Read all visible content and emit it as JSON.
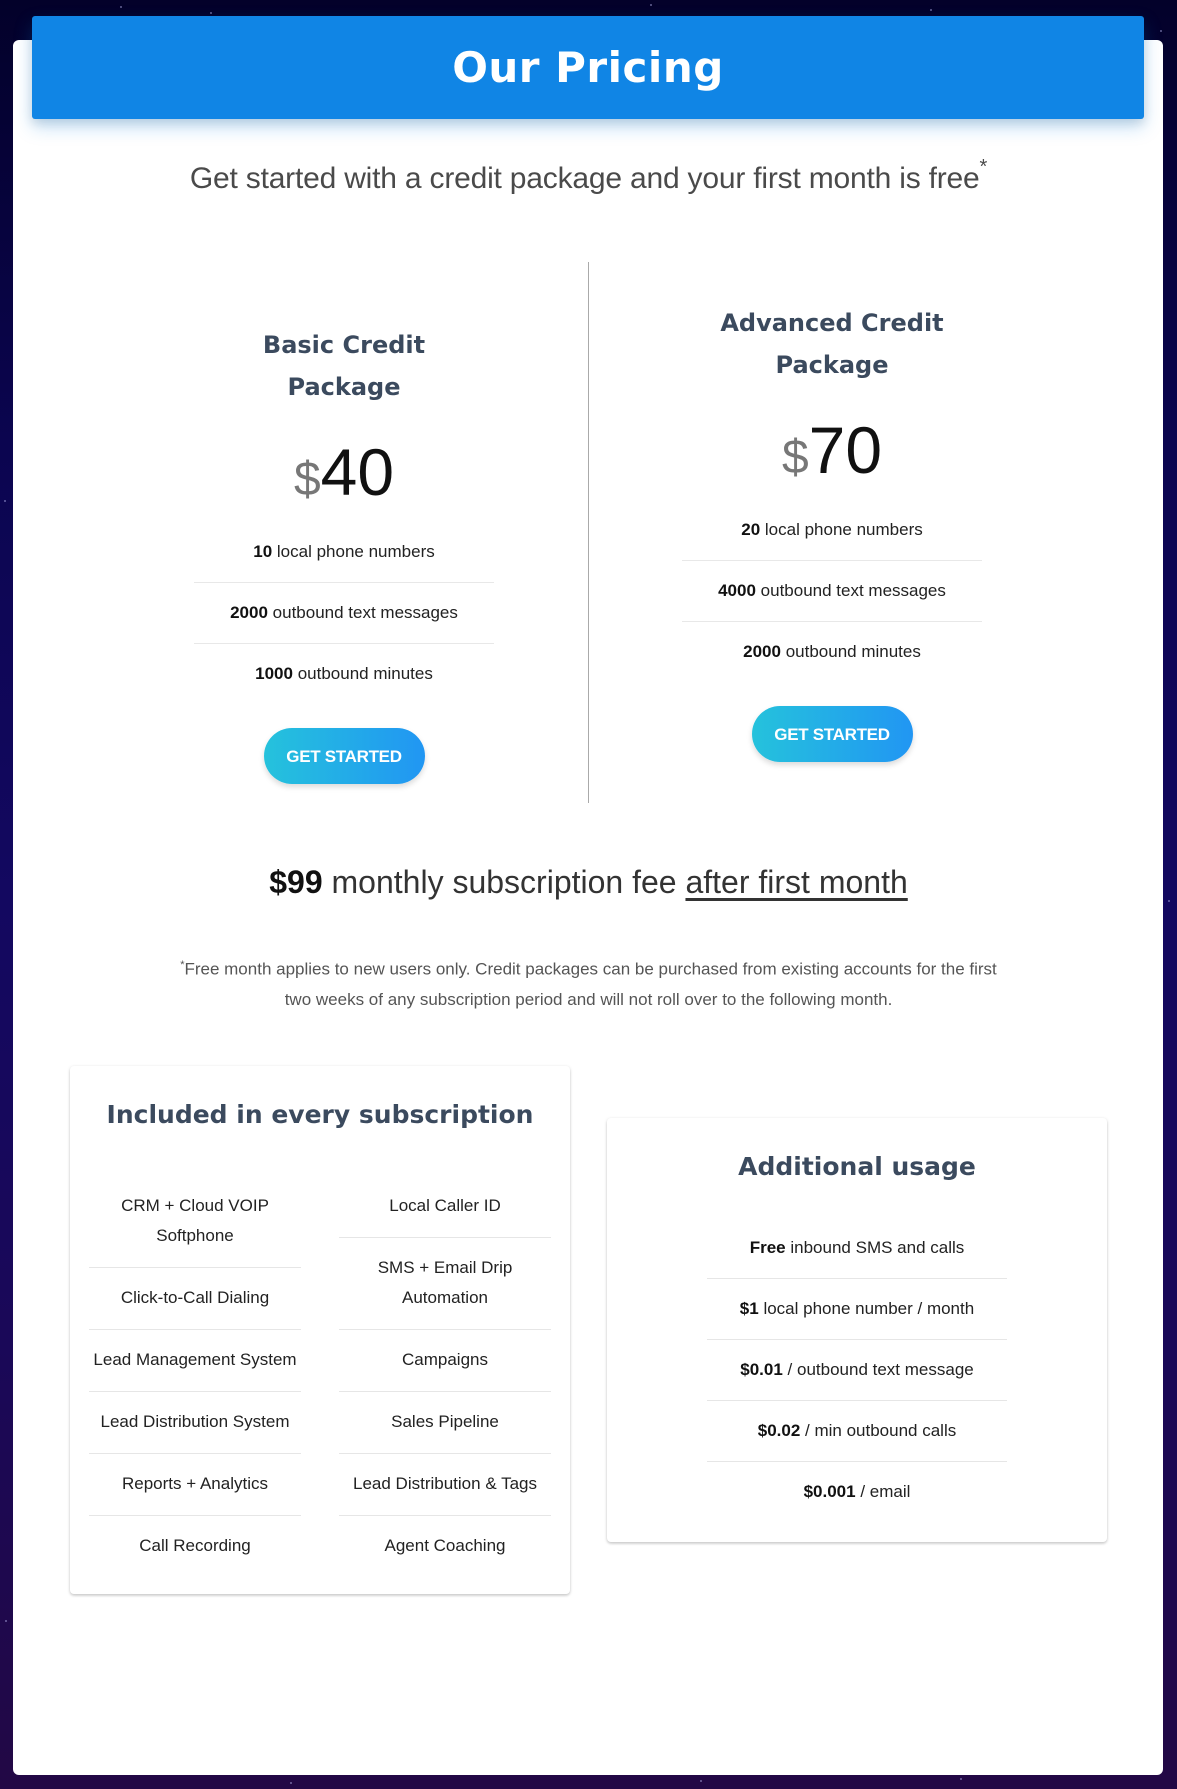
{
  "header": {
    "title": "Our Pricing",
    "color": "#1085e5"
  },
  "subtitle": {
    "text": "Get started with a credit package and your first month is free",
    "marker": "*"
  },
  "packages": [
    {
      "title": "Basic Credit Package",
      "currency": "$",
      "price": "40",
      "features": [
        {
          "value": "10",
          "label": "local phone numbers"
        },
        {
          "value": "2000",
          "label": "outbound text messages"
        },
        {
          "value": "1000",
          "label": "outbound minutes"
        }
      ],
      "button_label": "GET STARTED"
    },
    {
      "title": "Advanced Credit Package",
      "currency": "$",
      "price": "70",
      "features": [
        {
          "value": "20",
          "label": "local phone numbers"
        },
        {
          "value": "4000",
          "label": "outbound text messages"
        },
        {
          "value": "2000",
          "label": "outbound minutes"
        }
      ],
      "button_label": "GET STARTED"
    }
  ],
  "subscription": {
    "price": "$99",
    "text": "monthly subscription fee",
    "emphasis": "after first month"
  },
  "footnote": {
    "marker": "*",
    "text": "Free month applies to new users only. Credit packages can be purchased from existing accounts for the first two weeks of any subscription period and will not roll over to the following month."
  },
  "included": {
    "title": "Included in every subscription",
    "left": [
      "CRM + Cloud VOIP Softphone",
      "Click-to-Call Dialing",
      "Lead Management System",
      "Lead Distribution System",
      "Reports + Analytics",
      "Call Recording"
    ],
    "right": [
      "Local Caller ID",
      "SMS + Email Drip Automation",
      "Campaigns",
      "Sales Pipeline",
      "Lead Distribution & Tags",
      "Agent Coaching"
    ]
  },
  "additional": {
    "title": "Additional usage",
    "items": [
      {
        "value": "Free",
        "label": "inbound SMS and calls"
      },
      {
        "value": "$1",
        "label": "local phone number / month"
      },
      {
        "value": "$0.01",
        "label": "/ outbound text message"
      },
      {
        "value": "$0.02",
        "label": "/ min outbound calls"
      },
      {
        "value": "$0.001",
        "label": "/ email"
      }
    ]
  }
}
